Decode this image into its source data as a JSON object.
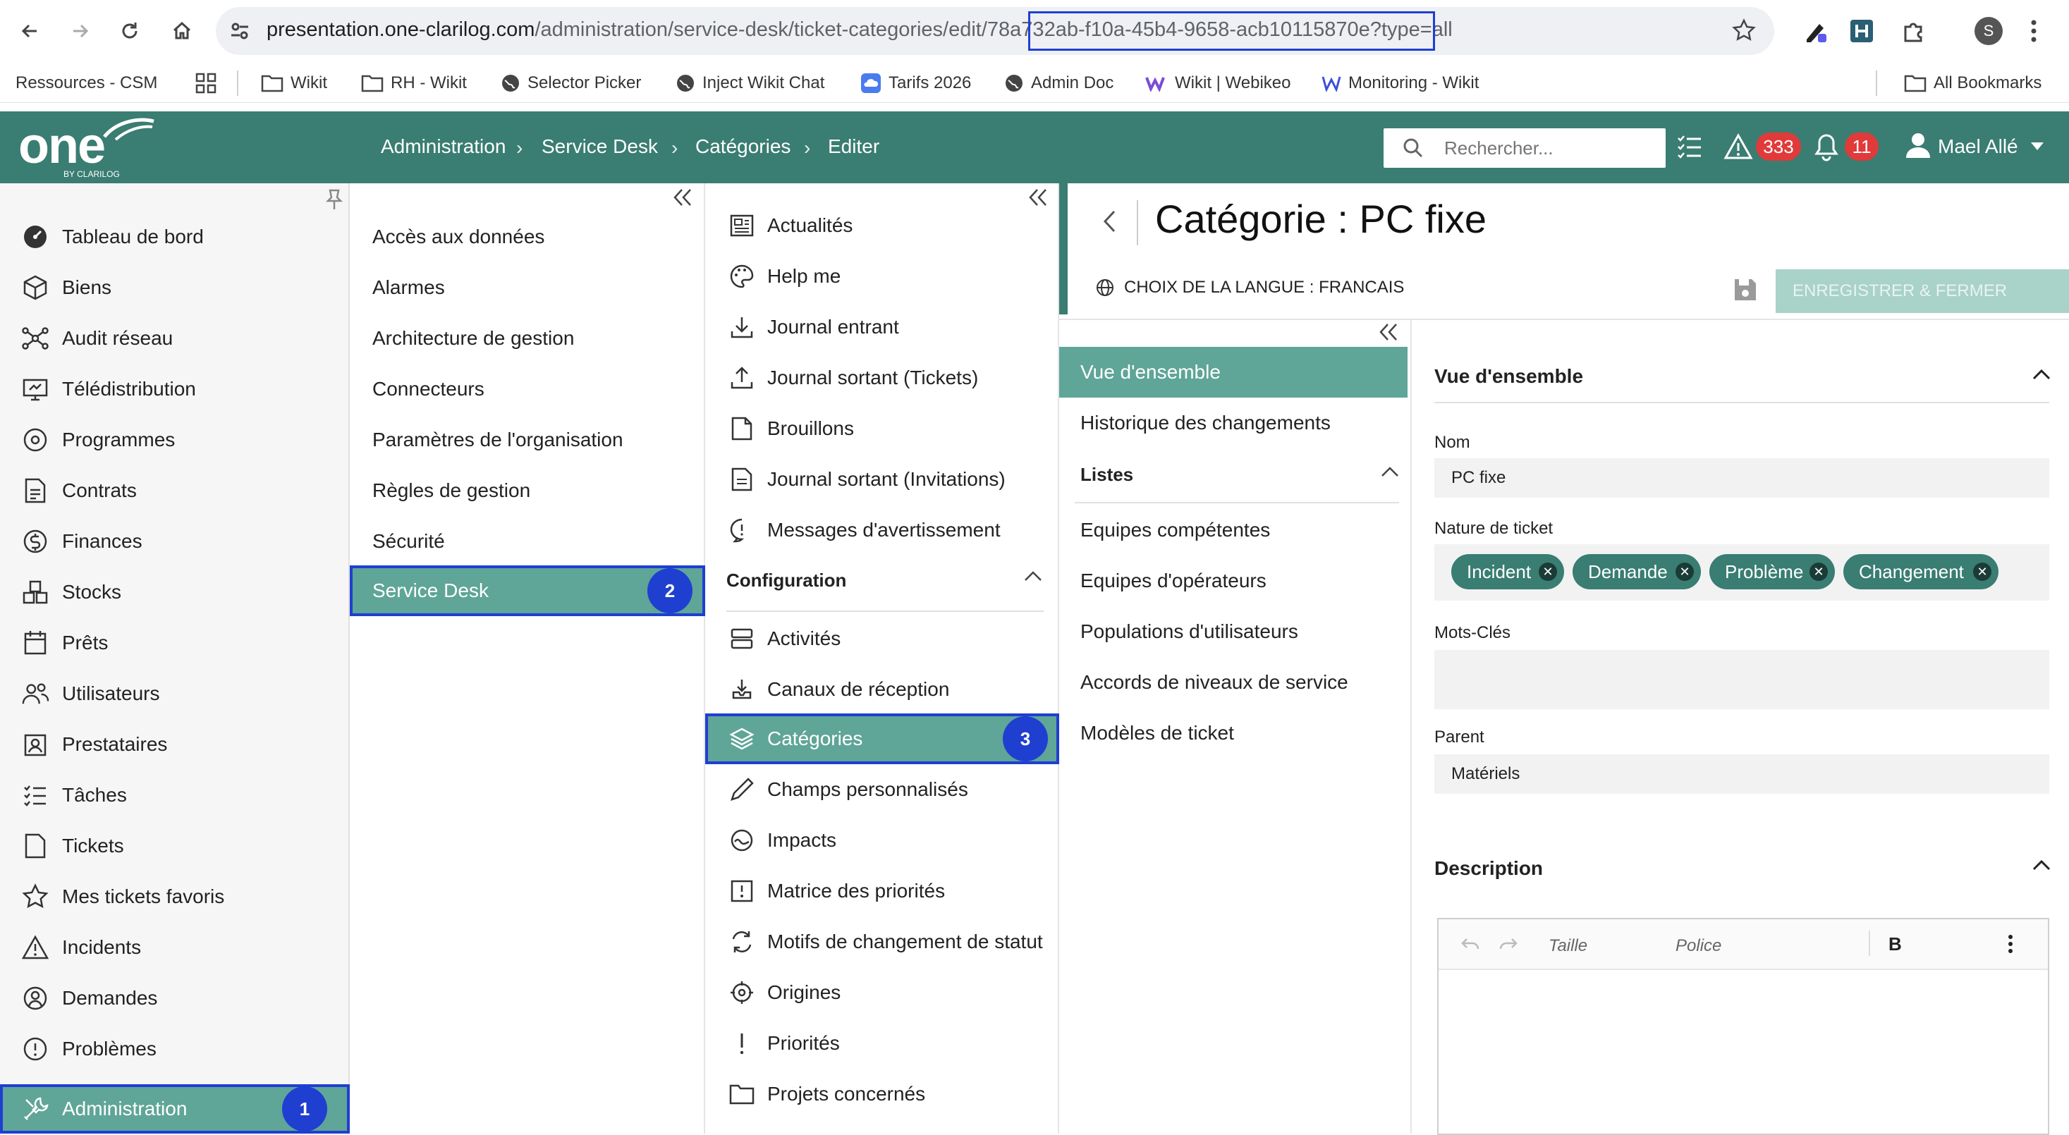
{
  "browser": {
    "url_host": "presentation.one-clarilog.com",
    "url_path": "/administration/service-desk/ticket-categories/edit/",
    "url_id": "78a732ab-f10a-45b4-9658-acb10115870e",
    "url_query": "?type=all",
    "profile_initial": "S"
  },
  "bookmarks": {
    "items": [
      "Ressources - CSM",
      "Wikit",
      "RH - Wikit",
      "Selector Picker",
      "Inject Wikit Chat",
      "Tarifs 2026",
      "Admin Doc",
      "Wikit | Webikeo",
      "Monitoring - Wikit"
    ],
    "all_bookmarks": "All Bookmarks"
  },
  "header": {
    "logo": "one",
    "logo_sub": "BY CLARILOG",
    "breadcrumbs": [
      "Administration",
      "Service Desk",
      "Catégories",
      "Editer"
    ],
    "search_placeholder": "Rechercher...",
    "incident_count": "333",
    "notif_count": "11",
    "user_name": "Mael Allé"
  },
  "sidebar": {
    "items": [
      "Tableau de bord",
      "Biens",
      "Audit réseau",
      "Télédistribution",
      "Programmes",
      "Contrats",
      "Finances",
      "Stocks",
      "Prêts",
      "Utilisateurs",
      "Prestataires",
      "Tâches",
      "Tickets",
      "Mes tickets favoris",
      "Incidents",
      "Demandes",
      "Problèmes",
      "Administration"
    ],
    "selected": "Administration",
    "selected_badge": "1"
  },
  "col2": {
    "items": [
      "Accès aux données",
      "Alarmes",
      "Architecture de gestion",
      "Connecteurs",
      "Paramètres de l'organisation",
      "Règles de gestion",
      "Sécurité",
      "Service Desk"
    ],
    "selected_badge": "2"
  },
  "col3": {
    "items": [
      "Actualités",
      "Help me",
      "Journal entrant",
      "Journal sortant (Tickets)",
      "Brouillons",
      "Journal sortant (Invitations)",
      "Messages d'avertissement"
    ],
    "section": "Configuration",
    "config_items": [
      "Activités",
      "Canaux de réception",
      "Catégories",
      "Champs personnalisés",
      "Impacts",
      "Matrice des priorités",
      "Motifs de changement de statut",
      "Origines",
      "Priorités",
      "Projets concernés"
    ],
    "selected_badge": "3"
  },
  "main": {
    "title": "Catégorie : PC fixe",
    "language": "CHOIX DE LA LANGUE : FRANCAIS",
    "save_label": "ENREGISTRER & FERMER",
    "nav": {
      "overview": "Vue d'ensemble",
      "history": "Historique des changements",
      "lists_header": "Listes",
      "lists": [
        "Equipes compétentes",
        "Equipes d'opérateurs",
        "Populations d'utilisateurs",
        "Accords de niveaux de service",
        "Modèles de ticket"
      ]
    },
    "form": {
      "section1": "Vue d'ensemble",
      "name_label": "Nom",
      "name_value": "PC fixe",
      "nature_label": "Nature de ticket",
      "nature_chips": [
        "Incident",
        "Demande",
        "Problème",
        "Changement"
      ],
      "keywords_label": "Mots-Clés",
      "parent_label": "Parent",
      "parent_value": "Matériels",
      "section2": "Description",
      "editor_size": "Taille",
      "editor_font": "Police",
      "editor_bold": "B"
    }
  },
  "colors": {
    "brand": "#3a7d72",
    "selected": "#5fa598",
    "highlight": "#1f3fd1",
    "badge": "#e03a3a"
  }
}
